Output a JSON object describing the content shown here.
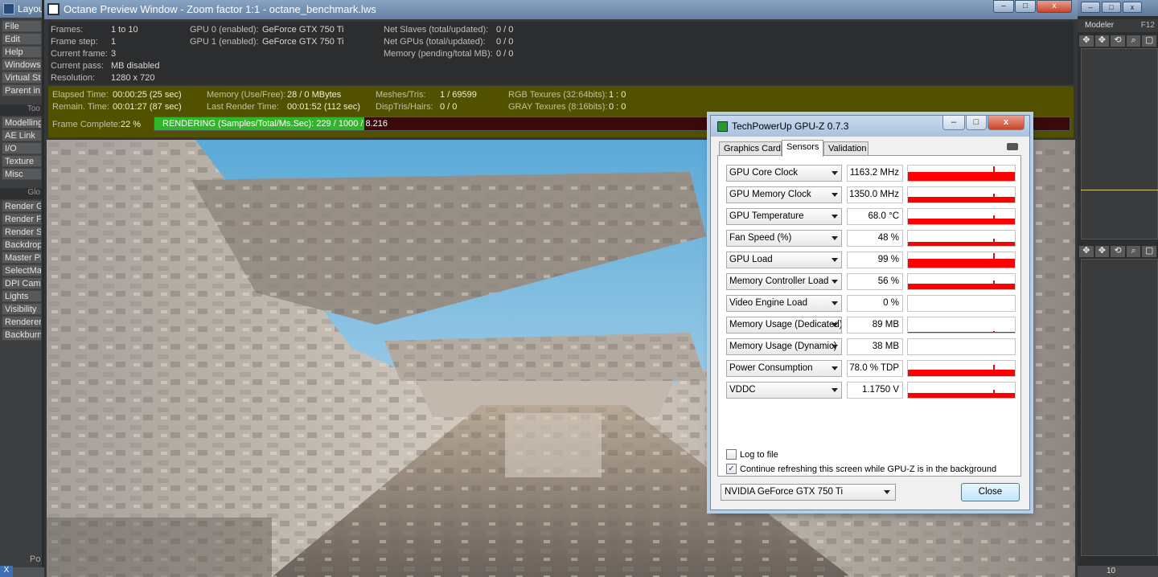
{
  "lightwave": {
    "title": "Layout",
    "menu_top": [
      "File",
      "Edit",
      "Help",
      "Windows",
      "Virtual Stu",
      "Parent in"
    ],
    "tools_head": "Too",
    "tools": [
      "Modelling",
      "AE Link",
      "I/O",
      "Texture",
      "Misc"
    ],
    "global_head": "Glo",
    "global": [
      "Render G",
      "Render Fr",
      "Render S",
      "Backdrop",
      "Master Pl",
      "SelectMa",
      "DPI Came",
      "Lights",
      "Visibility",
      "Renderer",
      "Backburn"
    ],
    "bottom_close": "X",
    "bottom_label": "Po"
  },
  "modeler": {
    "title": "Modeler",
    "shortcut": "F12",
    "frame_value": "10"
  },
  "octane": {
    "title": "Octane Preview Window - Zoom factor 1:1 - octane_benchmark.lws",
    "info": {
      "frames_label": "Frames:",
      "frames_value": "1 to 10",
      "framestep_label": "Frame step:",
      "framestep_value": "1",
      "curframe_label": "Current frame:",
      "curframe_value": "3",
      "curpass_label": "Current pass:",
      "curpass_value": "MB disabled",
      "resolution_label": "Resolution:",
      "resolution_value": "1280 x 720",
      "gpu0_label": "GPU  0 (enabled):",
      "gpu0_value": "GeForce GTX 750 Ti",
      "gpu1_label": "GPU  1 (enabled):",
      "gpu1_value": "GeForce GTX 750 Ti",
      "netslaves_label": "Net Slaves (total/updated):",
      "netslaves_value": "0 / 0",
      "netgpus_label": "Net GPUs (total/updated):",
      "netgpus_value": "0 / 0",
      "memory_label": "Memory (pending/total MB):",
      "memory_value": "0 / 0"
    },
    "stats": {
      "elapsed_label": "Elapsed Time:",
      "elapsed_value": "00:00:25 (25 sec)",
      "remain_label": "Remain. Time:",
      "remain_value": "00:01:27 (87 sec)",
      "mem_label": "Memory (Use/Free):",
      "mem_value": "28 / 0 MBytes",
      "last_label": "Last Render Time:",
      "last_value": "00:01:52 (112 sec)",
      "meshes_label": "Meshes/Tris:",
      "meshes_value": "1 / 69599",
      "disp_label": "DispTris/Hairs:",
      "disp_value": "0 / 0",
      "rgb_label": "RGB Texures (32:64bits):",
      "rgb_value": "1 : 0",
      "gray_label": "GRAY Texures (8:16bits):",
      "gray_value": "0 : 0",
      "complete_label": "Frame Complete:",
      "complete_value": "22 %",
      "progress_fraction": 0.229,
      "progress_text": "RENDERING (Samples/Total/Ms.Sec): 229 / 1000 / ",
      "progress_tail": "8.216"
    }
  },
  "gpuz": {
    "title": "TechPowerUp GPU-Z 0.7.3",
    "tabs": [
      "Graphics Card",
      "Sensors",
      "Validation"
    ],
    "active_tab": "Sensors",
    "sensors": [
      {
        "name": "GPU Core Clock",
        "value": "1163.2 MHz",
        "level": 0.9
      },
      {
        "name": "GPU Memory Clock",
        "value": "1350.0 MHz",
        "level": 0.55
      },
      {
        "name": "GPU Temperature",
        "value": "68.0 °C",
        "level": 0.55
      },
      {
        "name": "Fan Speed (%)",
        "value": "48 %",
        "level": 0.45
      },
      {
        "name": "GPU Load",
        "value": "99 %",
        "level": 0.9
      },
      {
        "name": "Memory Controller Load",
        "value": "56 %",
        "level": 0.55
      },
      {
        "name": "Video Engine Load",
        "value": "0 %",
        "level": 0
      },
      {
        "name": "Memory Usage (Dedicated)",
        "value": "89 MB",
        "level": 0.05
      },
      {
        "name": "Memory Usage (Dynamic)",
        "value": "38 MB",
        "level": 0
      },
      {
        "name": "Power Consumption",
        "value": "78.0 % TDP",
        "level": 0.7
      },
      {
        "name": "VDDC",
        "value": "1.1750 V",
        "level": 0.5
      }
    ],
    "log_label": "Log to file",
    "log_checked": false,
    "refresh_label": "Continue refreshing this screen while GPU-Z is in the background",
    "refresh_checked": true,
    "device": "NVIDIA GeForce GTX 750 Ti",
    "close_label": "Close",
    "btn_min": "–",
    "btn_max": "□",
    "btn_close": "x"
  },
  "colors": {
    "graph_red": "#ff0000",
    "progress_green": "#32b52a",
    "stats_bg": "#525100"
  }
}
